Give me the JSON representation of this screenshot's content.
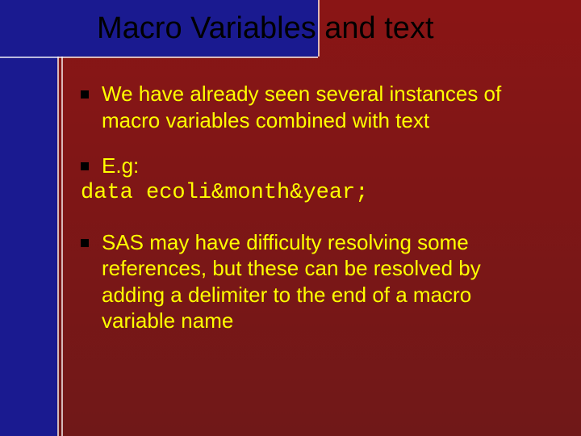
{
  "title": "Macro Variables and text",
  "bullets": {
    "b1": "We have already seen several instances of macro variables combined with text",
    "b2": "E.g:",
    "code": "data ecoli&month&year;",
    "b3": "SAS may have difficulty resolving some references, but these can be resolved by adding a delimiter to the end of a macro variable name"
  }
}
